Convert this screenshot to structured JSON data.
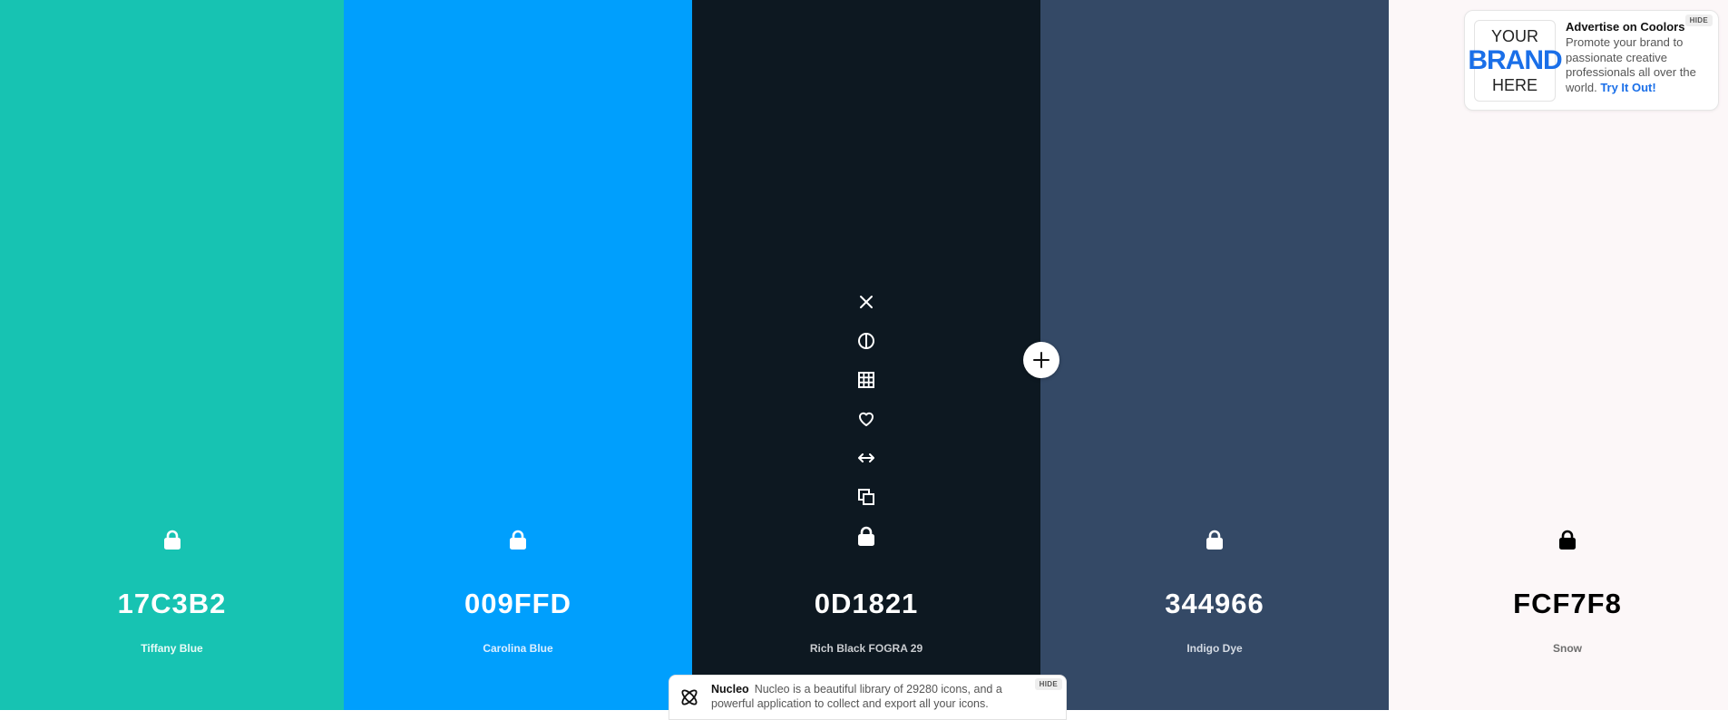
{
  "palette": [
    {
      "hex": "17C3B2",
      "name": "Tiffany Blue",
      "bg": "#17C3B2",
      "fg": "#ffffff",
      "name_color": "#e8fbf8",
      "locked": false
    },
    {
      "hex": "009FFD",
      "name": "Carolina Blue",
      "bg": "#009FFD",
      "fg": "#ffffff",
      "name_color": "#dcefff",
      "locked": false
    },
    {
      "hex": "0D1821",
      "name": "Rich Black FOGRA 29",
      "bg": "#0D1821",
      "fg": "#ffffff",
      "name_color": "#c9ccd0",
      "locked": false
    },
    {
      "hex": "344966",
      "name": "Indigo Dye",
      "bg": "#344966",
      "fg": "#ffffff",
      "name_color": "#d4dae3",
      "locked": false
    },
    {
      "hex": "FCF7F8",
      "name": "Snow",
      "bg": "#FCF7F8",
      "fg": "#000000",
      "name_color": "#6e6e6e",
      "locked": false
    }
  ],
  "tools": [
    "close-icon",
    "contrast-icon",
    "shades-grid-icon",
    "favorite-heart-icon",
    "drag-arrows-icon",
    "copy-icon",
    "lock-icon"
  ],
  "ad": {
    "logo_line1": "YOUR",
    "logo_line2": "BRAND",
    "logo_line3": "HERE",
    "title": "Advertise on Coolors",
    "text": "Promote your brand to passionate creative professionals all over the world.",
    "link": "Try It Out!",
    "hide": "HIDE"
  },
  "notice": {
    "title": "Nucleo",
    "text": "Nucleo is a beautiful library of 29280 icons, and a powerful application to collect and export all your icons.",
    "hide": "HIDE"
  }
}
